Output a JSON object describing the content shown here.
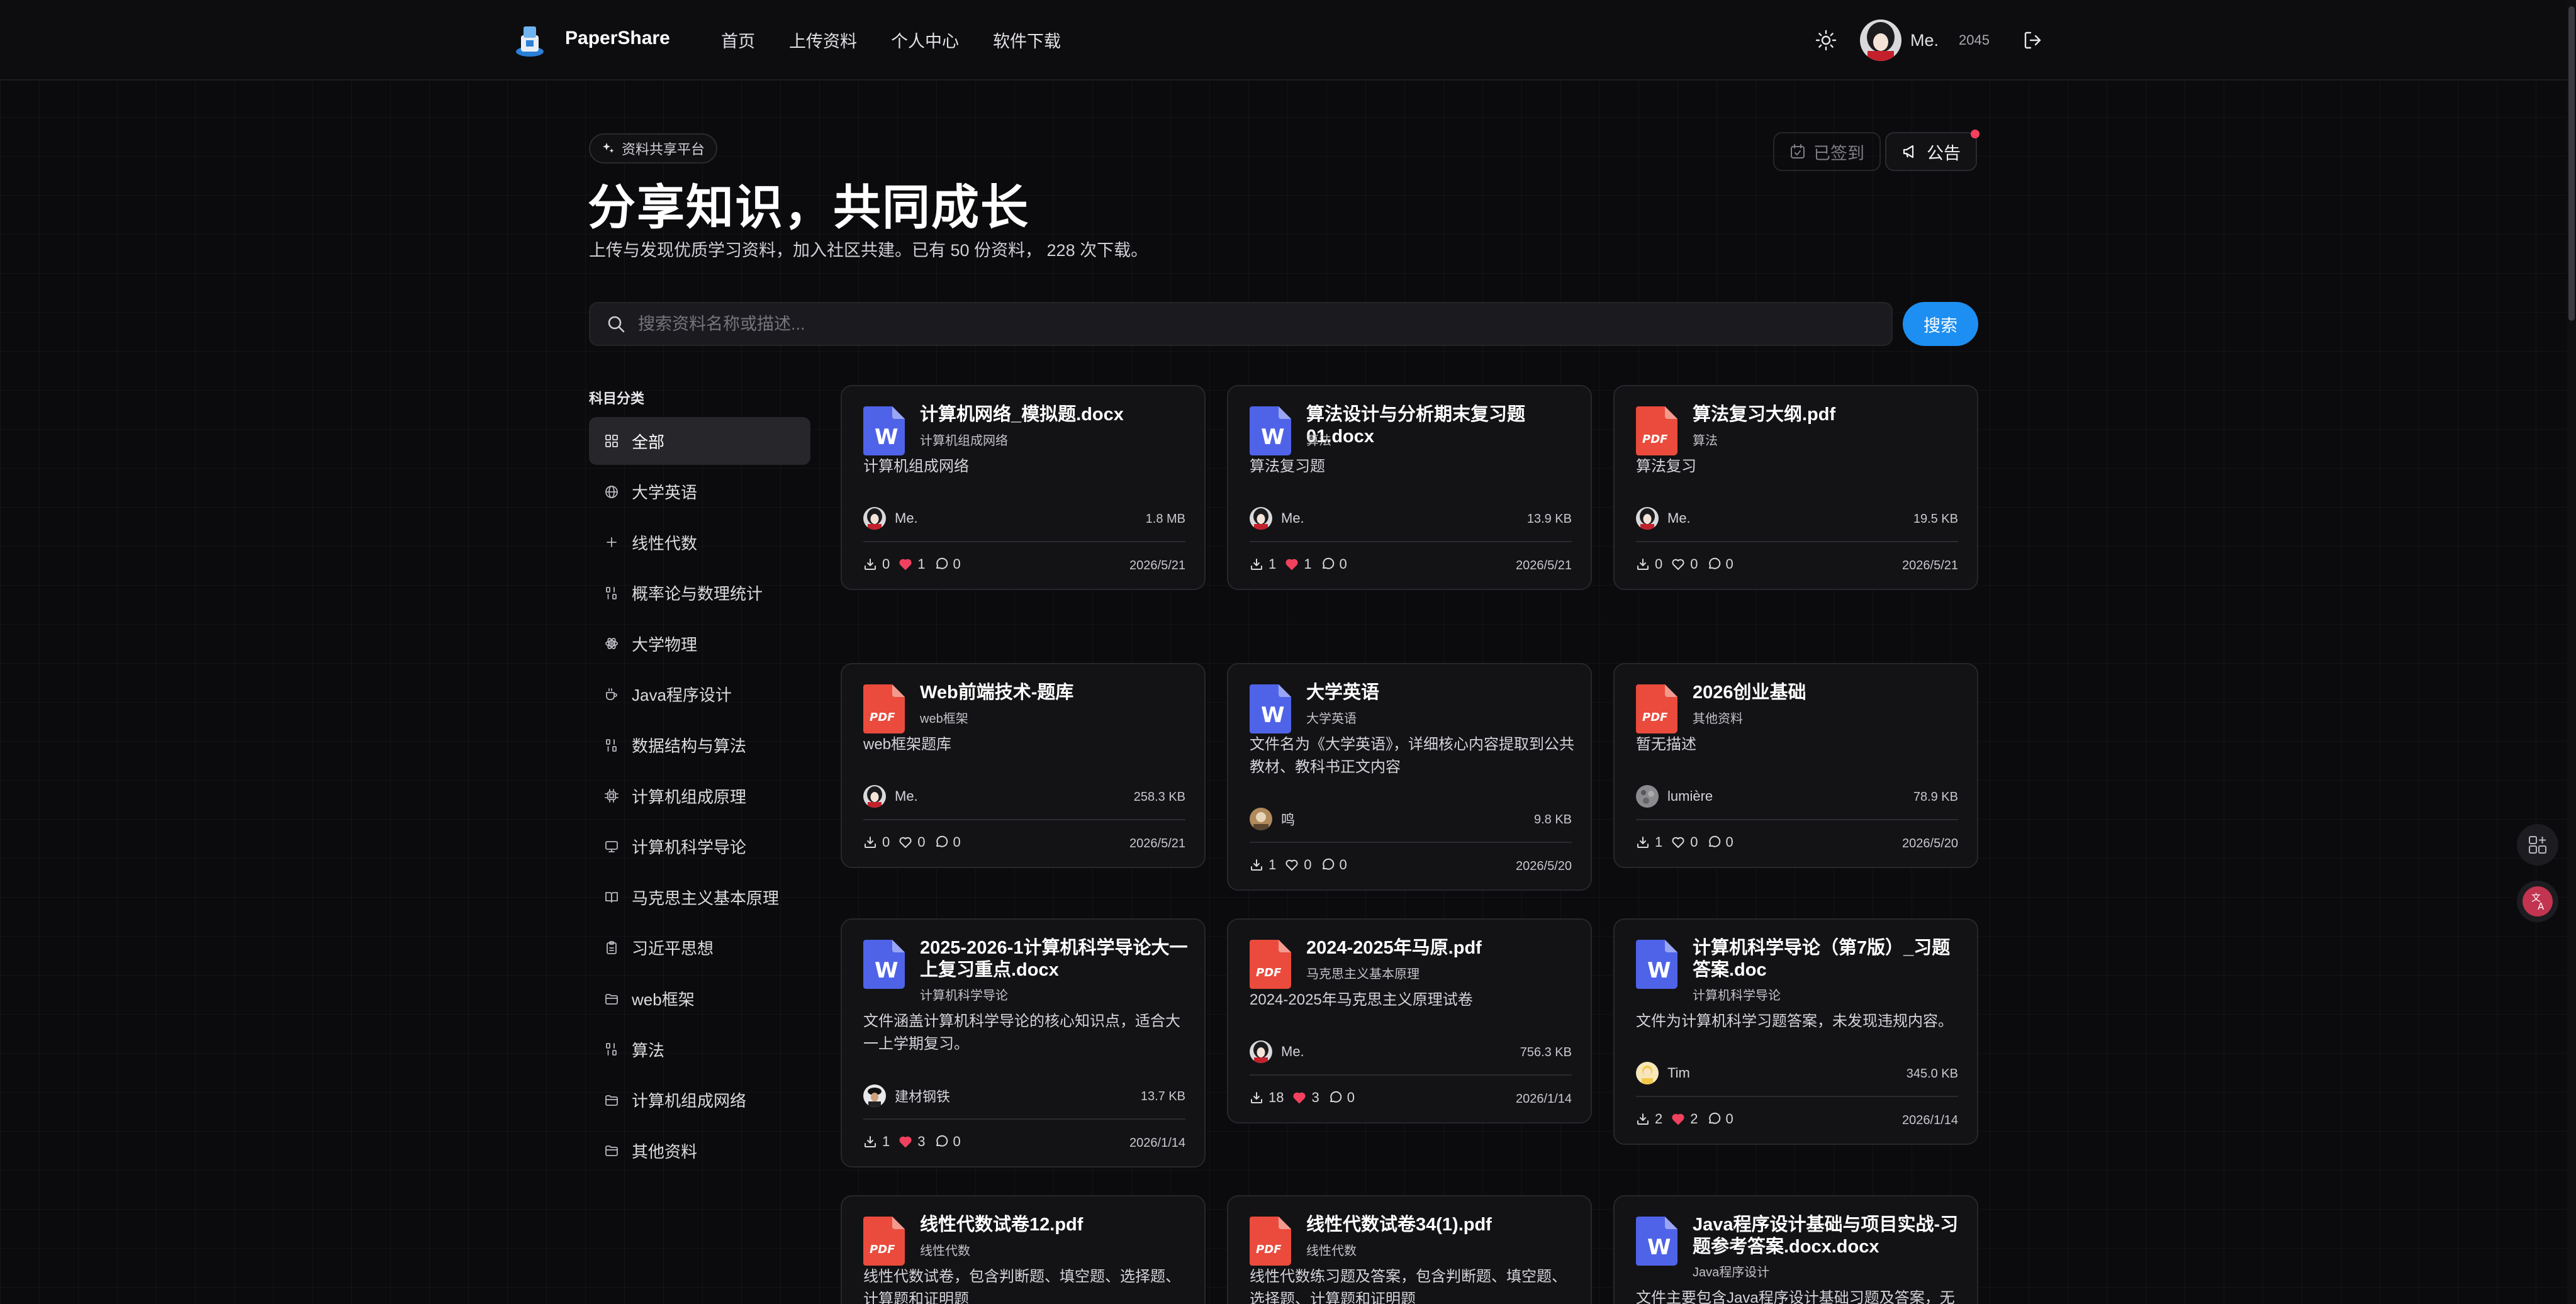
{
  "header": {
    "brand": "PaperShare",
    "nav": [
      "首页",
      "上传资料",
      "个人中心",
      "软件下载"
    ],
    "user_name": "Me.",
    "points": "2045"
  },
  "hero": {
    "badge": "资料共享平台",
    "title": "分享知识，共同成长",
    "subtitle": "上传与发现优质学习资料，加入社区共建。已有 50 份资料， 228 次下载。",
    "checked_in": "已签到",
    "notice": "公告"
  },
  "search": {
    "placeholder": "搜索资料名称或描述...",
    "button": "搜索"
  },
  "sidebar": {
    "title": "科目分类",
    "items": [
      {
        "label": "全部",
        "icon": "grid-icon"
      },
      {
        "label": "大学英语",
        "icon": "globe-icon"
      },
      {
        "label": "线性代数",
        "icon": "plus-icon"
      },
      {
        "label": "概率论与数理统计",
        "icon": "dice-icon"
      },
      {
        "label": "大学物理",
        "icon": "atom-icon"
      },
      {
        "label": "Java程序设计",
        "icon": "coffee-icon"
      },
      {
        "label": "数据结构与算法",
        "icon": "binary-icon"
      },
      {
        "label": "计算机组成原理",
        "icon": "cpu-icon"
      },
      {
        "label": "计算机科学导论",
        "icon": "monitor-icon"
      },
      {
        "label": "马克思主义基本原理",
        "icon": "book-icon"
      },
      {
        "label": "习近平思想",
        "icon": "clipboard-icon"
      },
      {
        "label": "web框架",
        "icon": "folder-icon"
      },
      {
        "label": "算法",
        "icon": "binary-icon"
      },
      {
        "label": "计算机组成网络",
        "icon": "folder-icon"
      },
      {
        "label": "其他资料",
        "icon": "folder-icon"
      }
    ]
  },
  "cards": [
    {
      "title": "计算机网络_模拟题.docx",
      "type": "word",
      "category": "计算机组成网络",
      "desc": "计算机组成网络",
      "user": "Me.",
      "size": "1.8 MB",
      "downloads": "0",
      "likes": "1",
      "liked": true,
      "comments": "0",
      "date": "2026/5/21"
    },
    {
      "title": "算法设计与分析期末复习题01.docx",
      "type": "word",
      "category": "算法",
      "desc": "算法复习题",
      "user": "Me.",
      "size": "13.9 KB",
      "downloads": "1",
      "likes": "1",
      "liked": true,
      "comments": "0",
      "date": "2026/5/21"
    },
    {
      "title": "算法复习大纲.pdf",
      "type": "pdf",
      "category": "算法",
      "desc": "算法复习",
      "user": "Me.",
      "size": "19.5 KB",
      "downloads": "0",
      "likes": "0",
      "liked": false,
      "comments": "0",
      "date": "2026/5/21"
    },
    {
      "title": "Web前端技术-题库",
      "type": "pdf",
      "category": "web框架",
      "desc": "web框架题库",
      "user": "Me.",
      "size": "258.3 KB",
      "downloads": "0",
      "likes": "0",
      "liked": false,
      "comments": "0",
      "date": "2026/5/21"
    },
    {
      "title": "大学英语",
      "type": "word",
      "category": "大学英语",
      "desc": "文件名为《大学英语》，详细核心内容提取到公共教材、教科书正文内容",
      "user": "鸣",
      "size": "9.8 KB",
      "downloads": "1",
      "likes": "0",
      "liked": false,
      "comments": "0",
      "date": "2026/5/20"
    },
    {
      "title": "2026创业基础",
      "type": "pdf",
      "category": "其他资料",
      "desc": "暂无描述",
      "user": "lumière",
      "size": "78.9 KB",
      "downloads": "1",
      "likes": "0",
      "liked": false,
      "comments": "0",
      "date": "2026/5/20"
    },
    {
      "title": "2025-2026-1计算机科学导论大一上复习重点.docx",
      "type": "word",
      "category": "计算机科学导论",
      "desc": "文件涵盖计算机科学导论的核心知识点，适合大一上学期复习。",
      "user": "建材钢铁",
      "size": "13.7 KB",
      "downloads": "1",
      "likes": "3",
      "liked": true,
      "comments": "0",
      "date": "2026/1/14"
    },
    {
      "title": "2024-2025年马原.pdf",
      "type": "pdf",
      "category": "马克思主义基本原理",
      "desc": "2024-2025年马克思主义原理试卷",
      "user": "Me.",
      "size": "756.3 KB",
      "downloads": "18",
      "likes": "3",
      "liked": true,
      "comments": "0",
      "date": "2026/1/14"
    },
    {
      "title": "计算机科学导论（第7版）_习题答案.doc",
      "type": "word",
      "category": "计算机科学导论",
      "desc": "文件为计算机科学习题答案，未发现违规内容。",
      "user": "Tim",
      "size": "345.0 KB",
      "downloads": "2",
      "likes": "2",
      "liked": true,
      "comments": "0",
      "date": "2026/1/14"
    },
    {
      "title": "线性代数试卷12.pdf",
      "type": "pdf",
      "category": "线性代数",
      "desc": "线性代数试卷，包含判断题、填空题、选择题、计算题和证明题",
      "user": "",
      "size": "",
      "downloads": "",
      "likes": "",
      "liked": false,
      "comments": "",
      "date": ""
    },
    {
      "title": "线性代数试卷34(1).pdf",
      "type": "pdf",
      "category": "线性代数",
      "desc": "线性代数练习题及答案，包含判断题、填空题、选择题、计算题和证明题",
      "user": "",
      "size": "",
      "downloads": "",
      "likes": "",
      "liked": false,
      "comments": "",
      "date": ""
    },
    {
      "title": "Java程序设计基础与项目实战-习题参考答案.docx.docx",
      "type": "word",
      "category": "Java程序设计",
      "desc": "文件主要包含Java程序设计基础习题及答案，无",
      "user": "",
      "size": "",
      "downloads": "",
      "likes": "",
      "liked": false,
      "comments": "",
      "date": ""
    }
  ],
  "colors": {
    "accent": "#1d8ff2",
    "word_icon": "#4f63e8",
    "pdf_icon": "#ea4b3c",
    "like": "#f0415e"
  }
}
